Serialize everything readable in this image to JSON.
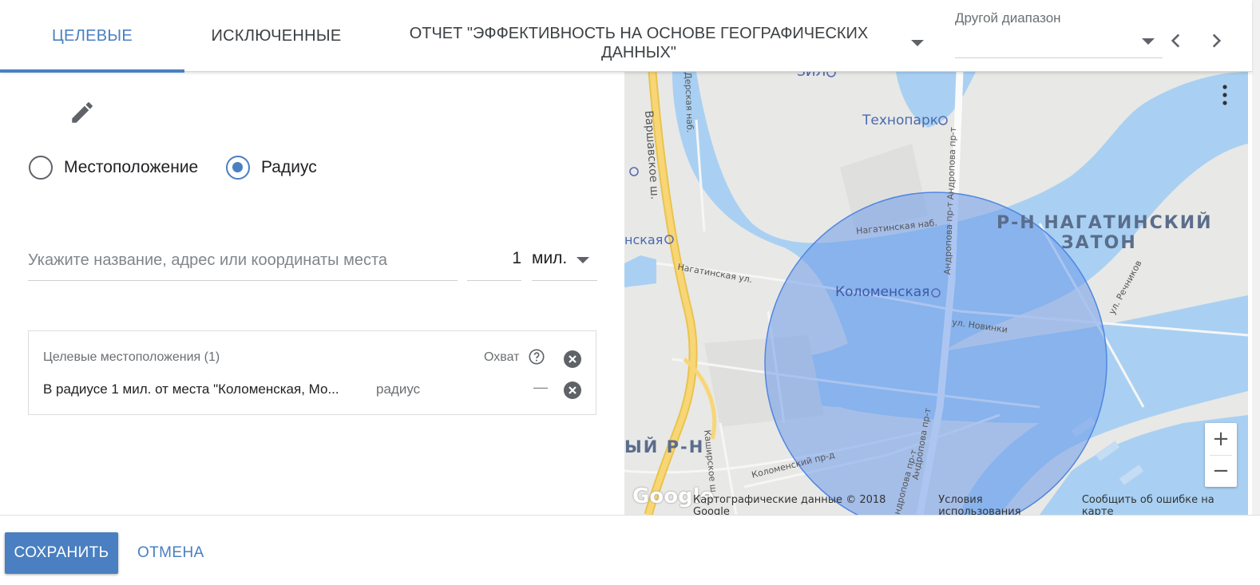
{
  "tabs": [
    {
      "label": "ЦЕЛЕВЫЕ",
      "active": true
    },
    {
      "label": "ИСКЛЮЧЕННЫЕ",
      "active": false
    }
  ],
  "report": {
    "line1": "ОТЧЕТ \"ЭФФЕКТИВНОСТЬ НА ОСНОВЕ ГЕОГРАФИЧЕСКИХ",
    "line2": "ДАННЫХ\""
  },
  "date_range": {
    "label": "Другой диапазон",
    "value": ""
  },
  "location_mode": {
    "options": [
      {
        "label": "Местоположение",
        "selected": false
      },
      {
        "label": "Радиус",
        "selected": true
      }
    ]
  },
  "search": {
    "placeholder": "Укажите название, адрес или координаты места",
    "value": ""
  },
  "radius": {
    "value": "1",
    "unit": "мил."
  },
  "targets": {
    "header": "Целевые местоположения (1)",
    "reach_label": "Охват",
    "rows": [
      {
        "text": "В радиусе 1 мил. от места \"Коломенская, Мо...",
        "type": "радиус",
        "reach": "—"
      }
    ]
  },
  "map": {
    "labels": {
      "zil": "ЗИЛ",
      "tekhnopark": "Технопарк",
      "kolomenskaya": "Коломенская",
      "nagatinsky_line1": "Р-Н НАГАТИНСКИЙ",
      "nagatinsky_line2": "ЗАТОН",
      "kashirskaya": "нская",
      "district_left": "ЫЙ Р-Н",
      "varshavskoe": "Варшавское ш.",
      "nagatinskaya_ul": "Нагатинская ул.",
      "nagatinskaya_nab": "Нагатинская наб.",
      "andropova1": "Андропова пр-т",
      "andropova2": "Андропова пр-т",
      "andropova3": "Андропова пр-т",
      "andropova4": "Андропова пр-т",
      "novinki": "ул. Новинки",
      "rechnikov": "ул. Речников",
      "kashirskoe": "Каширское ш.",
      "kolomensky_pr": "Коломенский пр-д",
      "top_street": "Дерская наб."
    },
    "attribution": [
      "Картографические данные © 2018 Google",
      "Условия использования",
      "Сообщить об ошибке на карте"
    ],
    "logo": "Google",
    "zoom_in": "+",
    "zoom_out": "−",
    "colors": {
      "water": "#a9d0f2",
      "land": "#e8e8e6",
      "road_major": "#f8d676",
      "circle_fill": "#6d9bea",
      "circle_stroke": "#4f86e0"
    }
  },
  "footer": {
    "save_label": "СОХРАНИТЬ",
    "cancel_label": "ОТМЕНА"
  },
  "colors": {
    "accent": "#4a7fc1"
  }
}
